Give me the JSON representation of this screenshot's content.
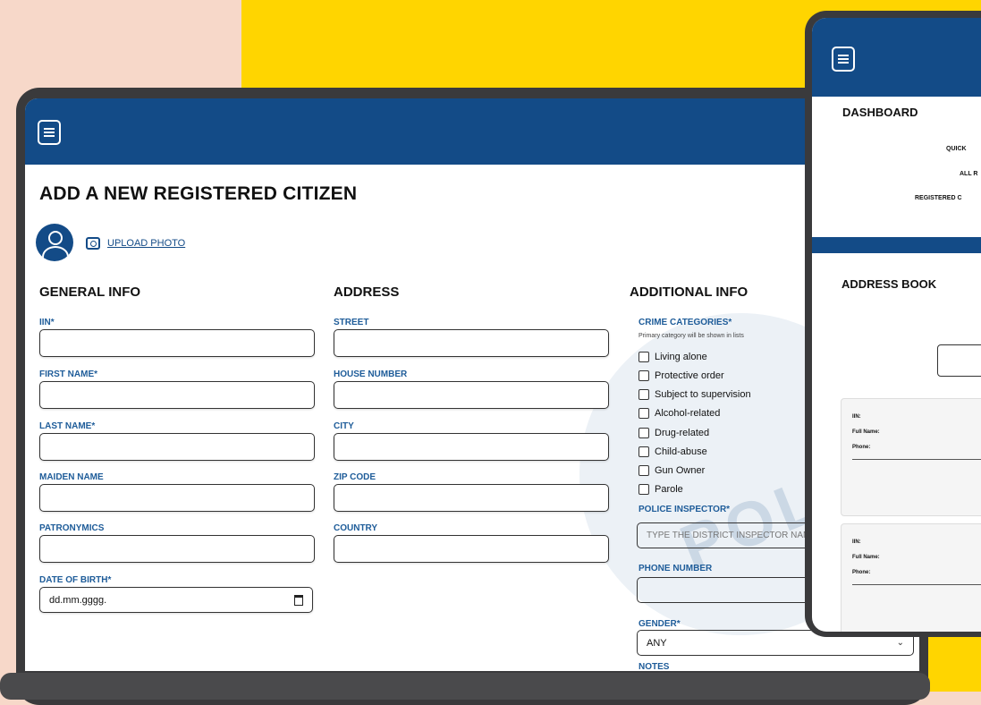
{
  "laptop": {
    "page_title": "ADD A NEW REGISTERED CITIZEN",
    "upload_label": "UPLOAD PHOTO",
    "sections": {
      "general": "GENERAL INFO",
      "address": "ADDRESS",
      "additional": "ADDITIONAL INFO"
    },
    "general_fields": [
      "IIN*",
      "FIRST NAME*",
      "LAST NAME*",
      "MAIDEN NAME",
      "PATRONYMICS",
      "DATE OF BIRTH*"
    ],
    "date_placeholder": "dd.mm.gggg.",
    "address_fields": [
      "STREET",
      "HOUSE NUMBER",
      "CITY",
      "ZIP CODE",
      "COUNTRY"
    ],
    "crime_categories_label": "CRIME CATEGORIES*",
    "crime_hint": "Primary category will be shown in lists",
    "crime_categories": [
      "Living alone",
      "Protective order",
      "Subject to supervision",
      "Alcohol-related",
      "Drug-related",
      "Child-abuse",
      "Gun Owner",
      "Parole"
    ],
    "police_inspector_label": "POLICE INSPECTOR*",
    "police_inspector_placeholder": "TYPE THE DISTRICT INSPECTOR NAME",
    "phone_label": "PHONE NUMBER",
    "gender_label": "GENDER*",
    "gender_value": "ANY",
    "notes_label": "NOTES"
  },
  "tablet": {
    "title": "DASHBOARD",
    "quick_label": "QUICK",
    "all_label": "ALL R",
    "registered_label": "REGISTERED C",
    "address_book": "ADDRESS BOOK",
    "cards": [
      {
        "iin": "IIN:",
        "full_name": "Full Name:",
        "phone": "Phone:"
      },
      {
        "iin": "IIN:",
        "full_name": "Full Name:",
        "phone": "Phone:"
      }
    ]
  }
}
